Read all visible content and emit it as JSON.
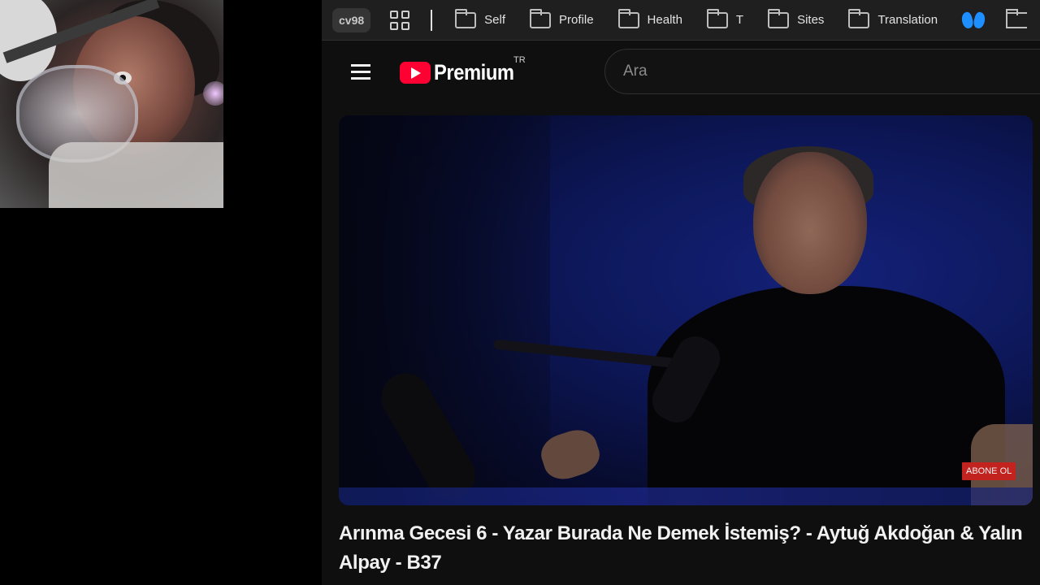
{
  "browser": {
    "profile": "cv98",
    "bookmarks": [
      {
        "label": "Self",
        "icon": "folder-icon"
      },
      {
        "label": "Profile",
        "icon": "folder-icon"
      },
      {
        "label": "Health",
        "icon": "folder-icon"
      },
      {
        "label": "T",
        "icon": "folder-icon"
      },
      {
        "label": "Sites",
        "icon": "folder-icon"
      },
      {
        "label": "Translation",
        "icon": "folder-icon"
      }
    ],
    "extra_icons": [
      "apps-grid-icon",
      "bluesky-butterfly-icon",
      "folder-icon"
    ]
  },
  "youtube": {
    "logo_text": "Premium",
    "region": "TR",
    "search_placeholder": "Ara",
    "video": {
      "subscribe_overlay": "ABONE OL",
      "title": "Arınma Gecesi 6 - Yazar Burada Ne Demek İstemiş? - Aytuğ Akdoğan & Yalın Alpay - B37"
    }
  },
  "colors": {
    "youtube_red": "#ff0033",
    "bluesky_blue": "#1e8fff",
    "subscribe_red": "#c2231f"
  }
}
